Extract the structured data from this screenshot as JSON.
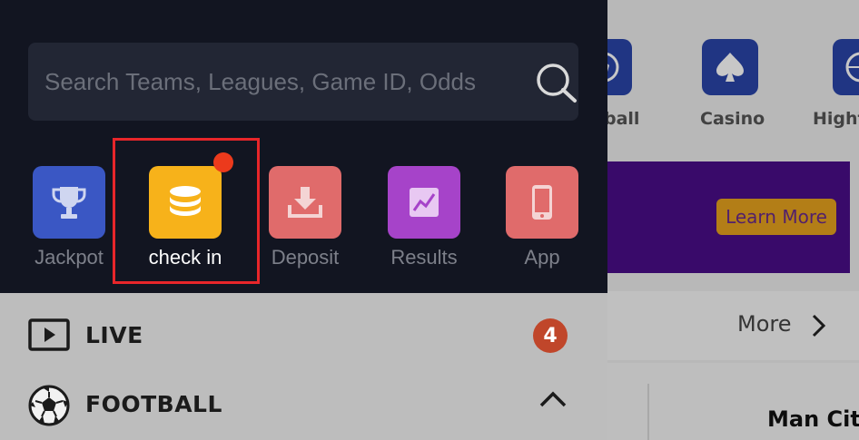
{
  "background": {
    "nav": [
      {
        "label": "ball",
        "icon": "football-icon"
      },
      {
        "label": "Casino",
        "icon": "spade-icon"
      },
      {
        "label": "Hight",
        "icon": "basketball-icon"
      }
    ],
    "banner_button": "Learn More",
    "more_label": "More",
    "team_name": "Man Cit"
  },
  "drawer": {
    "search": {
      "placeholder": "Search Teams, Leagues, Game ID, Odds",
      "value": ""
    },
    "quick_actions": [
      {
        "label": "Jackpot",
        "icon": "trophy-icon",
        "color": "#3a57c4"
      },
      {
        "label": "check in",
        "icon": "coins-icon",
        "color": "#f7b21a"
      },
      {
        "label": "Deposit",
        "icon": "download-icon",
        "color": "#e06b6b"
      },
      {
        "label": "Results",
        "icon": "chart-icon",
        "color": "#a643c9"
      },
      {
        "label": "App",
        "icon": "phone-icon",
        "color": "#e06b6b"
      }
    ],
    "menu": [
      {
        "label": "LIVE",
        "icon": "play-icon",
        "count": "4"
      },
      {
        "label": "FOOTBALL",
        "icon": "soccer-ball-icon"
      }
    ]
  },
  "colors": {
    "drawer_bg": "#121521",
    "highlight": "#e8262a",
    "notification": "#ec3a1c"
  }
}
